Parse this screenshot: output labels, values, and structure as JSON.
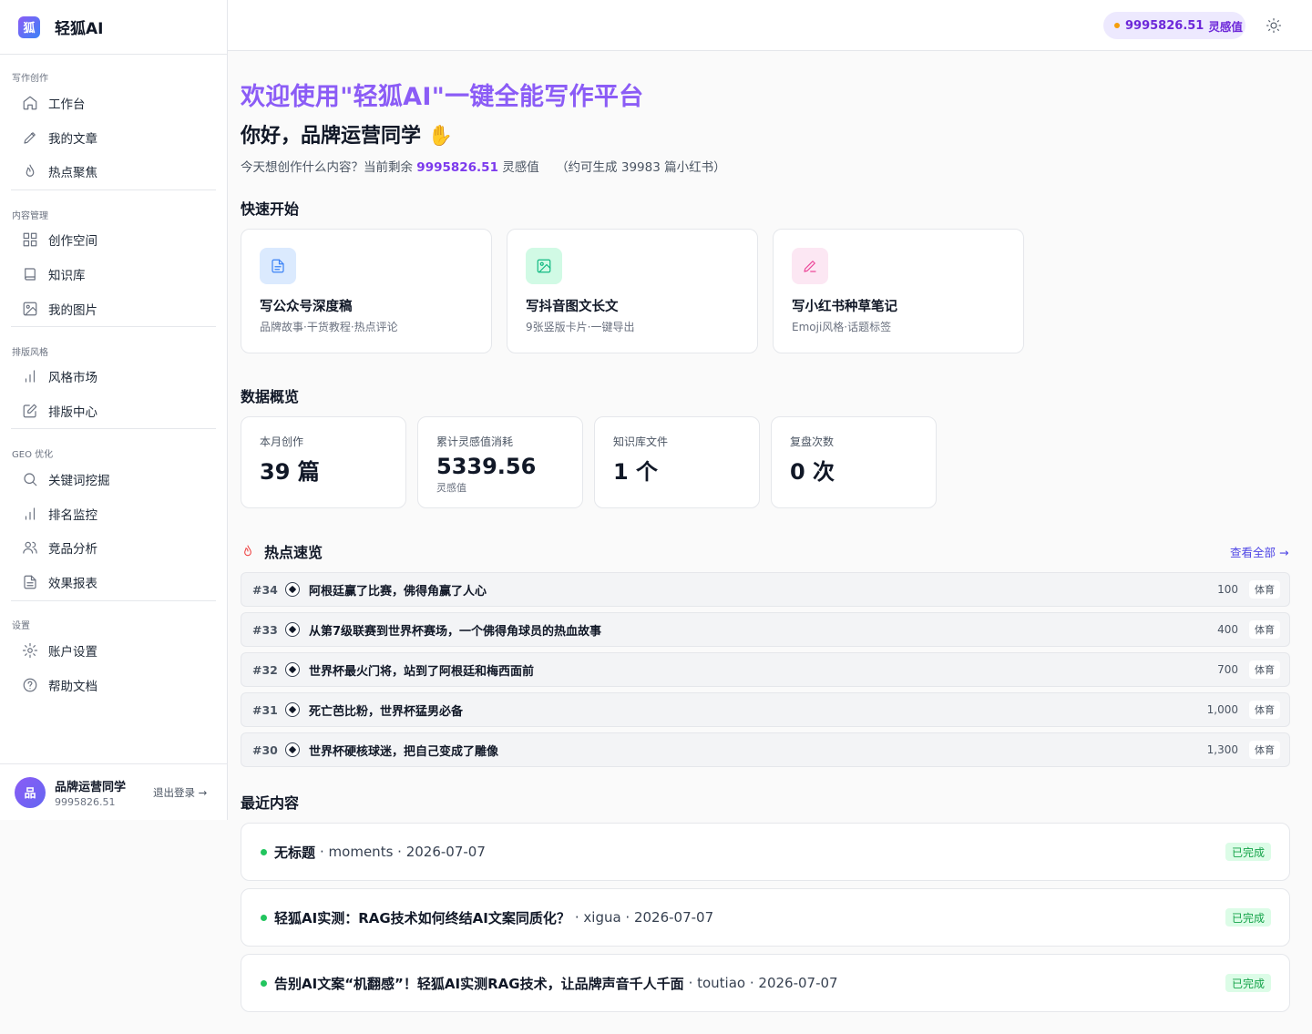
{
  "brand": {
    "name": "轻狐AI",
    "logo_text": "狐"
  },
  "top": {
    "credit_value": "9995826.51",
    "credit_unit": "灵感值"
  },
  "sidebar": {
    "sections": [
      {
        "title": "写作创作",
        "items": [
          {
            "label": "工作台",
            "icon": "home-icon"
          },
          {
            "label": "我的文章",
            "icon": "pencil-icon"
          },
          {
            "label": "热点聚焦",
            "icon": "flame-icon"
          }
        ]
      },
      {
        "title": "内容管理",
        "items": [
          {
            "label": "创作空间",
            "icon": "grid-icon"
          },
          {
            "label": "知识库",
            "icon": "book-icon"
          },
          {
            "label": "我的图片",
            "icon": "image-icon"
          }
        ]
      },
      {
        "title": "排版风格",
        "items": [
          {
            "label": "风格市场",
            "icon": "bar-chart-icon"
          },
          {
            "label": "排版中心",
            "icon": "edit-icon"
          }
        ]
      },
      {
        "title": "GEO 优化",
        "items": [
          {
            "label": "关键词挖掘",
            "icon": "search-icon"
          },
          {
            "label": "排名监控",
            "icon": "bar-chart-icon"
          },
          {
            "label": "竞品分析",
            "icon": "users-icon"
          },
          {
            "label": "效果报表",
            "icon": "file-icon"
          }
        ]
      },
      {
        "title": "设置",
        "items": [
          {
            "label": "账户设置",
            "icon": "gear-icon"
          },
          {
            "label": "帮助文档",
            "icon": "help-icon"
          }
        ]
      }
    ]
  },
  "user": {
    "avatar": "品",
    "name": "品牌运营同学",
    "credit": "9995826.51",
    "logout": "退出登录 →"
  },
  "main": {
    "welcome": "欢迎使用\"轻狐AI\"一键全能写作平台",
    "greeting": "你好，品牌运营同学 ✋",
    "subline_prefix": "今天想创作什么内容？当前剩余",
    "subline_value": "9995826.51",
    "subline_unit": "灵感值",
    "subline_estimate": "（约可生成 39983 篇小红书）"
  },
  "quick_start": {
    "title": "快速开始",
    "cards": [
      {
        "title": "写公众号深度稿",
        "desc": "品牌故事·干货教程·热点评论",
        "icon": "document-icon",
        "bg": "#dbeafe",
        "color": "#3b82f6"
      },
      {
        "title": "写抖音图文长文",
        "desc": "9张竖版卡片·一键导出",
        "icon": "image-icon",
        "bg": "#d1fae5",
        "color": "#10b981"
      },
      {
        "title": "写小红书种草笔记",
        "desc": "Emoji风格·话题标签",
        "icon": "pen-icon",
        "bg": "#fce7f3",
        "color": "#ec4899"
      }
    ]
  },
  "overview": {
    "title": "数据概览",
    "stats": [
      {
        "label": "本月创作",
        "value": "39 篇",
        "sub": ""
      },
      {
        "label": "累计灵感值消耗",
        "value": "5339.56",
        "sub": "灵感值"
      },
      {
        "label": "知识库文件",
        "value": "1 个",
        "sub": ""
      },
      {
        "label": "复盘次数",
        "value": "0 次",
        "sub": ""
      }
    ]
  },
  "hot": {
    "title": "热点速览",
    "view_all": "查看全部 →",
    "items": [
      {
        "rank": "#34",
        "title": "阿根廷赢了比赛，佛得角赢了人心",
        "score": "100",
        "tag": "体育"
      },
      {
        "rank": "#33",
        "title": "从第7级联赛到世界杯赛场，一个佛得角球员的热血故事",
        "score": "400",
        "tag": "体育"
      },
      {
        "rank": "#32",
        "title": "世界杯最火门将，站到了阿根廷和梅西面前",
        "score": "700",
        "tag": "体育"
      },
      {
        "rank": "#31",
        "title": "死亡芭比粉，世界杯猛男必备",
        "score": "1,000",
        "tag": "体育"
      },
      {
        "rank": "#30",
        "title": "世界杯硬核球迷，把自己变成了雕像",
        "score": "1,300",
        "tag": "体育"
      }
    ]
  },
  "recent": {
    "title": "最近内容",
    "items": [
      {
        "title": "无标题",
        "meta": "· moments · 2026-07-07",
        "status": "已完成"
      },
      {
        "title": "轻狐AI实测：RAG技术如何终结AI文案同质化？",
        "meta": "· xigua · 2026-07-07",
        "status": "已完成"
      },
      {
        "title": "告别AI文案“机翻感”！轻狐AI实测RAG技术，让品牌声音千人千面",
        "meta": "· toutiao · 2026-07-07",
        "status": "已完成"
      }
    ]
  },
  "colors": {
    "accent": "#8b5cf6",
    "credit": "#7c3aed",
    "success": "#22c55e",
    "hot": "#ef4444"
  }
}
